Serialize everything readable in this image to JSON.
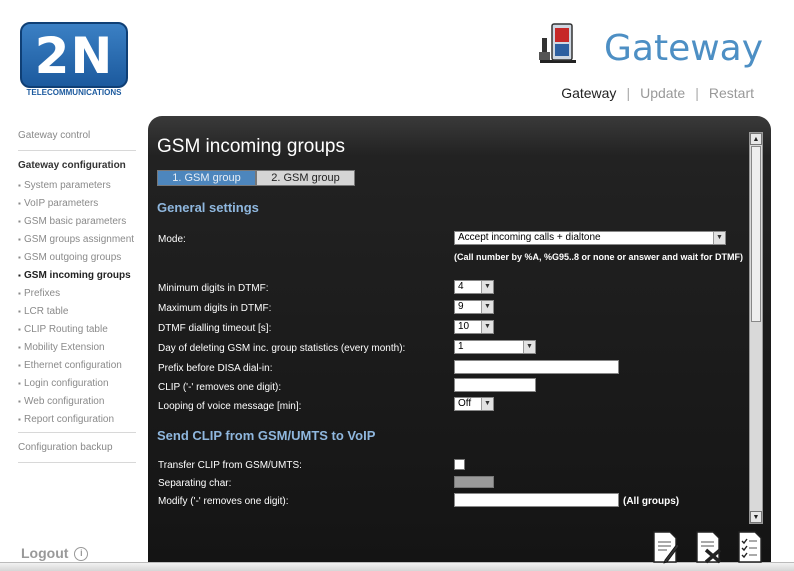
{
  "brand": {
    "logo_text": "2N",
    "logo_subtitle": "TELECOMMUNICATIONS",
    "product_title": "Gateway"
  },
  "topnav": [
    {
      "label": "Gateway",
      "active": true
    },
    {
      "label": "Update",
      "active": false
    },
    {
      "label": "Restart",
      "active": false
    }
  ],
  "sidebar": {
    "gateway_control": "Gateway control",
    "gateway_configuration": "Gateway configuration",
    "items": [
      "System parameters",
      "VoIP parameters",
      "GSM basic parameters",
      "GSM groups assignment",
      "GSM outgoing groups",
      "GSM incoming groups",
      "Prefixes",
      "LCR table",
      "CLIP Routing table",
      "Mobility Extension",
      "Ethernet configuration",
      "Login configuration",
      "Web configuration",
      "Report configuration"
    ],
    "active_item": "GSM incoming groups",
    "configuration_backup": "Configuration backup",
    "logout": "Logout"
  },
  "page": {
    "title": "GSM incoming groups",
    "tabs": [
      {
        "label": "1. GSM group",
        "active": true
      },
      {
        "label": "2. GSM group",
        "active": false
      }
    ]
  },
  "general_settings": {
    "title": "General settings",
    "mode_label": "Mode:",
    "mode_value": "Accept incoming calls + dialtone",
    "mode_note": "(Call number by %A, %G95..8 or none or answer and wait for DTMF)",
    "min_digits_label": "Minimum digits in DTMF:",
    "min_digits_value": "4",
    "max_digits_label": "Maximum digits in DTMF:",
    "max_digits_value": "9",
    "timeout_label": "DTMF dialling timeout [s]:",
    "timeout_value": "10",
    "stats_day_label": "Day of deleting GSM inc. group statistics (every month):",
    "stats_day_value": "1",
    "prefix_label": "Prefix before DISA dial-in:",
    "prefix_value": "",
    "clip_label": "CLIP ('-' removes one digit):",
    "clip_value": "",
    "looping_label": "Looping of voice message [min]:",
    "looping_value": "Off"
  },
  "send_clip": {
    "title": "Send CLIP from GSM/UMTS to VoIP",
    "transfer_label": "Transfer CLIP from GSM/UMTS:",
    "transfer_checked": false,
    "separator_label": "Separating char:",
    "separator_value": "",
    "modify_label": "Modify ('-' removes one digit):",
    "modify_value": "",
    "all_groups": "(All groups)"
  },
  "icons": {
    "save": "document-pen-icon",
    "cancel": "document-cross-icon",
    "checklist": "document-checklist-icon",
    "gateway": "gateway-phone-icon",
    "logout": "power-icon"
  },
  "colors": {
    "accent_blue": "#4d86bd",
    "panel_dark": "#1e1e1e",
    "section_title": "#8fb7de"
  }
}
